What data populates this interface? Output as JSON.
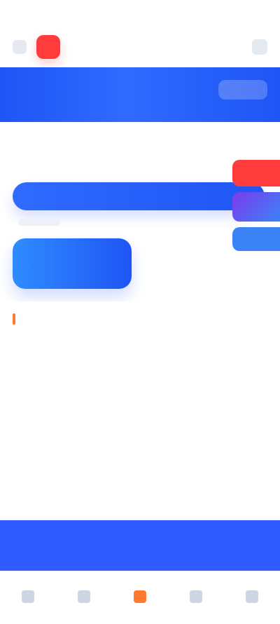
{
  "status_bar": {
    "time": "",
    "right": ""
  },
  "header": {
    "title": "",
    "brand_color": "#ff3b3b"
  },
  "banner": {
    "left_text": "",
    "right_text": ""
  },
  "overview": {
    "label": "",
    "value": "",
    "action_label": ""
  },
  "big_action": {
    "label": ""
  },
  "side_actions": [
    {
      "label": "",
      "color": "#ff3b3b"
    },
    {
      "label": "",
      "color": "#7c3aed"
    },
    {
      "label": "",
      "color": "#3b82f6"
    }
  ],
  "info": {
    "section_title": "",
    "items": [
      {
        "title": "",
        "meta": ""
      },
      {
        "title": "",
        "meta": ""
      }
    ],
    "grid": [
      {
        "title": "",
        "meta": ""
      },
      {
        "title": "",
        "meta": ""
      },
      {
        "title": "",
        "meta": ""
      },
      {
        "title": "",
        "meta": ""
      }
    ]
  },
  "primary_cta": {
    "label": ""
  },
  "tabbar": [
    {
      "label": "",
      "icon": "home-icon",
      "active": false
    },
    {
      "label": "",
      "icon": "discover-icon",
      "active": false
    },
    {
      "label": "",
      "icon": "orders-icon",
      "active": true
    },
    {
      "label": "",
      "icon": "messages-icon",
      "active": false
    },
    {
      "label": "",
      "icon": "profile-icon",
      "active": false
    }
  ],
  "colors": {
    "blue": "#2f6bff",
    "blue_dark": "#1f55f5",
    "green": "#2fc07a",
    "orange": "#ff7a2f"
  }
}
